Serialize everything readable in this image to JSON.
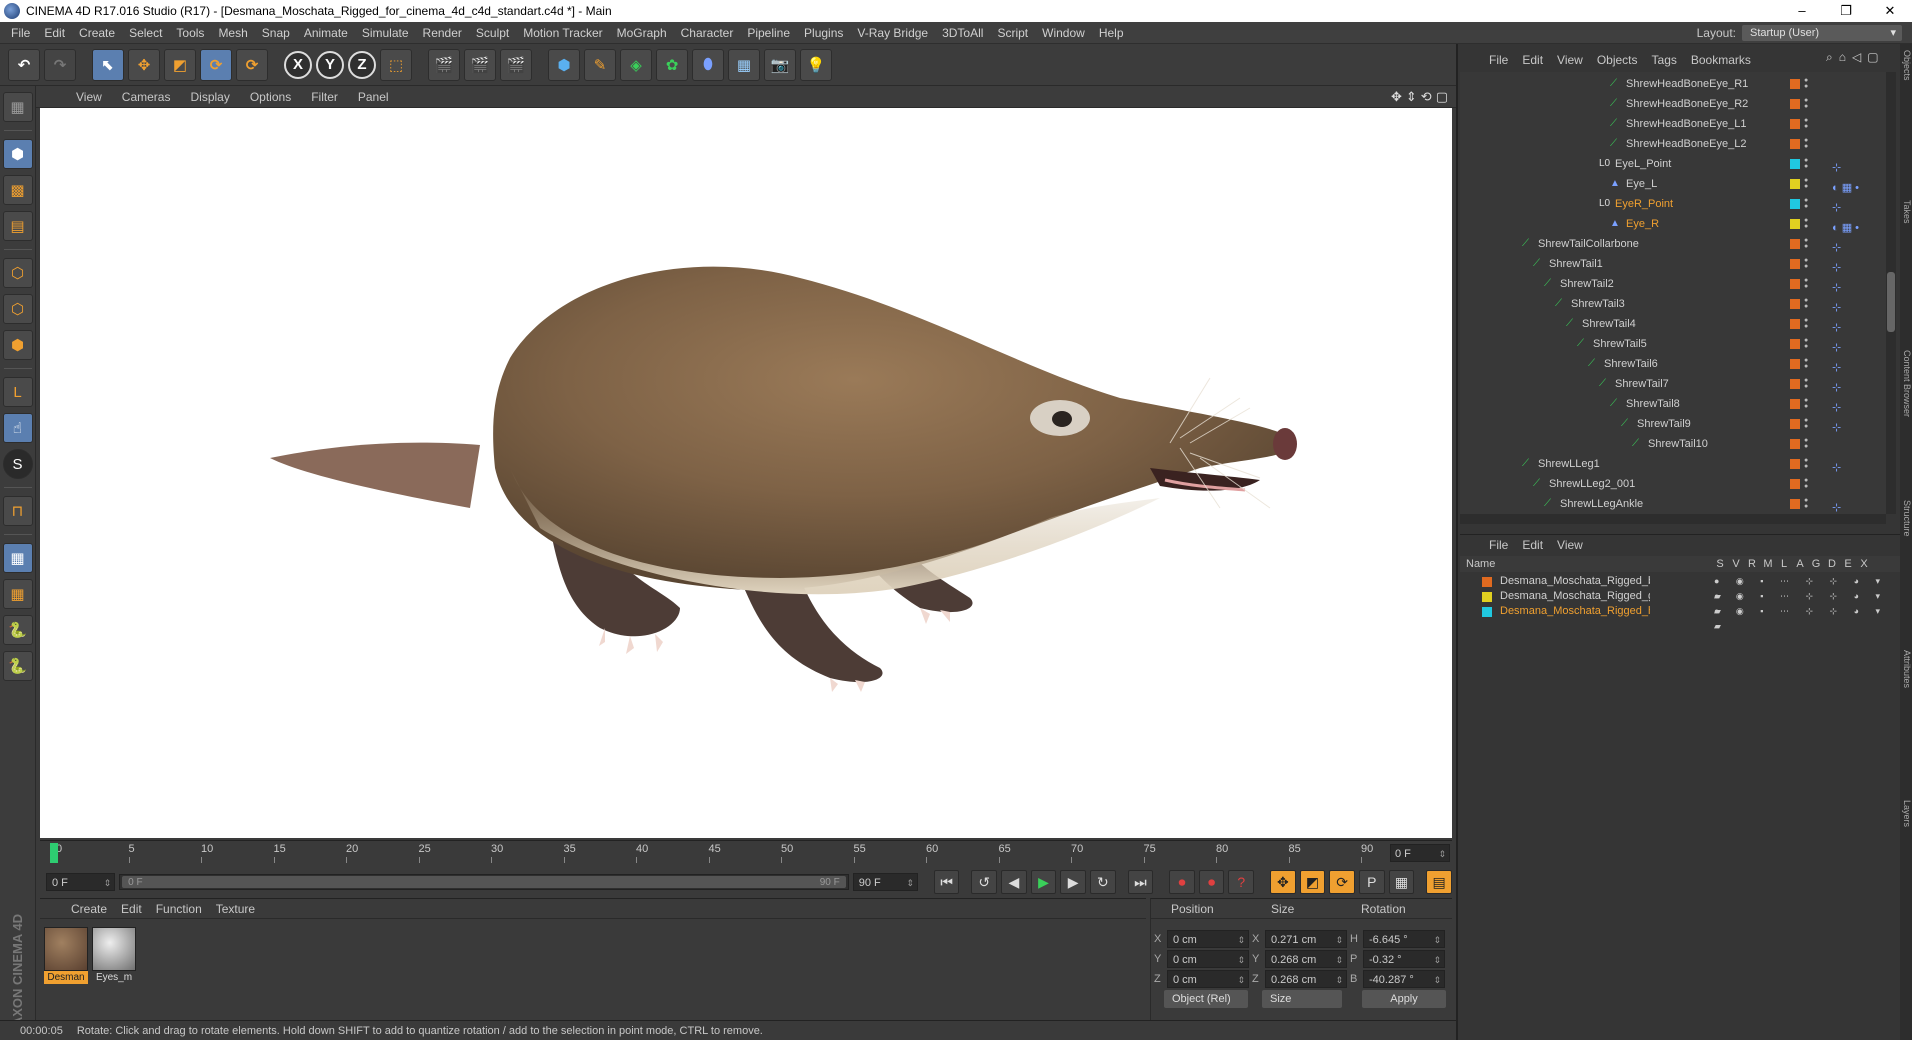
{
  "window": {
    "title": "CINEMA 4D R17.016 Studio (R17) - [Desmana_Moschata_Rigged_for_cinema_4d_c4d_standart.c4d *] - Main",
    "min": "–",
    "max": "❐",
    "close": "✕"
  },
  "menubar": [
    "File",
    "Edit",
    "Create",
    "Select",
    "Tools",
    "Mesh",
    "Snap",
    "Animate",
    "Simulate",
    "Render",
    "Sculpt",
    "Motion Tracker",
    "MoGraph",
    "Character",
    "Pipeline",
    "Plugins",
    "V-Ray Bridge",
    "3DToAll",
    "Script",
    "Window",
    "Help"
  ],
  "layout": {
    "label": "Layout:",
    "value": "Startup (User)"
  },
  "toolbar": {
    "axes": [
      "X",
      "Y",
      "Z"
    ]
  },
  "viewport": {
    "menu": [
      "View",
      "Cameras",
      "Display",
      "Options",
      "Filter",
      "Panel"
    ],
    "nav_icons": [
      "move-view-icon",
      "scale-view-icon",
      "rotate-view-icon",
      "maximize-view-icon"
    ]
  },
  "timeline": {
    "ticks": [
      "0",
      "5",
      "10",
      "15",
      "20",
      "25",
      "30",
      "35",
      "40",
      "45",
      "50",
      "55",
      "60",
      "65",
      "70",
      "75",
      "80",
      "85",
      "90"
    ],
    "current_frame": "0 F"
  },
  "transport": {
    "start": "0 F",
    "range_start": "0 F",
    "range_end": "90 F",
    "end": "90 F"
  },
  "materials": {
    "menu": [
      "Create",
      "Edit",
      "Function",
      "Texture"
    ],
    "items": [
      {
        "name": "Desman",
        "selected": true
      },
      {
        "name": "Eyes_m",
        "selected": false
      }
    ]
  },
  "coordinates": {
    "headers": [
      "Position",
      "Size",
      "Rotation"
    ],
    "rows": [
      {
        "axis": "X",
        "pos": "0 cm",
        "size_axis": "X",
        "size": "0.271 cm",
        "rot_axis": "H",
        "rot": "-6.645 °"
      },
      {
        "axis": "Y",
        "pos": "0 cm",
        "size_axis": "Y",
        "size": "0.268 cm",
        "rot_axis": "P",
        "rot": "-0.32 °"
      },
      {
        "axis": "Z",
        "pos": "0 cm",
        "size_axis": "Z",
        "size": "0.268 cm",
        "rot_axis": "B",
        "rot": "-40.287 °"
      }
    ],
    "mode": "Object (Rel)",
    "size_mode": "Size",
    "apply": "Apply"
  },
  "status": {
    "time": "00:00:05",
    "message": "Rotate: Click and drag to rotate elements. Hold down SHIFT to add to quantize rotation / add to the selection in point mode, CTRL to remove."
  },
  "objects": {
    "menu": [
      "File",
      "Edit",
      "View",
      "Objects",
      "Tags",
      "Bookmarks"
    ],
    "rows": [
      {
        "name": "ShrewHeadBoneEye_R1",
        "depth": 8,
        "color": "#e06a20",
        "tag": ""
      },
      {
        "name": "ShrewHeadBoneEye_R2",
        "depth": 8,
        "color": "#e06a20",
        "tag": ""
      },
      {
        "name": "ShrewHeadBoneEye_L1",
        "depth": 8,
        "color": "#e06a20",
        "tag": ""
      },
      {
        "name": "ShrewHeadBoneEye_L2",
        "depth": 8,
        "color": "#e06a20",
        "tag": ""
      },
      {
        "name": "EyeL_Point",
        "depth": 7,
        "color": "#20c8e0",
        "tag": "⊹",
        "null": true
      },
      {
        "name": "Eye_L",
        "depth": 8,
        "color": "#e0d020",
        "tag": "◐ ▦ •",
        "mesh": true
      },
      {
        "name": "EyeR_Point",
        "depth": 7,
        "color": "#20c8e0",
        "tag": "⊹",
        "null": true,
        "highlight": true
      },
      {
        "name": "Eye_R",
        "depth": 8,
        "color": "#e0d020",
        "tag": "◐ ▦ •",
        "mesh": true,
        "highlight": true
      },
      {
        "name": "ShrewTailCollarbone",
        "depth": 0,
        "color": "#e06a20",
        "tag": "⊹"
      },
      {
        "name": "ShrewTail1",
        "depth": 1,
        "color": "#e06a20",
        "tag": "⊹"
      },
      {
        "name": "ShrewTail2",
        "depth": 2,
        "color": "#e06a20",
        "tag": "⊹"
      },
      {
        "name": "ShrewTail3",
        "depth": 3,
        "color": "#e06a20",
        "tag": "⊹"
      },
      {
        "name": "ShrewTail4",
        "depth": 4,
        "color": "#e06a20",
        "tag": "⊹"
      },
      {
        "name": "ShrewTail5",
        "depth": 5,
        "color": "#e06a20",
        "tag": "⊹"
      },
      {
        "name": "ShrewTail6",
        "depth": 6,
        "color": "#e06a20",
        "tag": "⊹"
      },
      {
        "name": "ShrewTail7",
        "depth": 7,
        "color": "#e06a20",
        "tag": "⊹"
      },
      {
        "name": "ShrewTail8",
        "depth": 8,
        "color": "#e06a20",
        "tag": "⊹"
      },
      {
        "name": "ShrewTail9",
        "depth": 9,
        "color": "#e06a20",
        "tag": "⊹"
      },
      {
        "name": "ShrewTail10",
        "depth": 10,
        "color": "#e06a20",
        "tag": ""
      },
      {
        "name": "ShrewLLeg1",
        "depth": 0,
        "color": "#e06a20",
        "tag": "⊹"
      },
      {
        "name": "ShrewLLeg2_001",
        "depth": 1,
        "color": "#e06a20",
        "tag": ""
      },
      {
        "name": "ShrewLLegAnkle",
        "depth": 2,
        "color": "#e06a20",
        "tag": "⊹"
      }
    ]
  },
  "layers": {
    "menu": [
      "File",
      "Edit",
      "View"
    ],
    "columns": [
      "Name",
      "S",
      "V",
      "R",
      "M",
      "L",
      "A",
      "G",
      "D",
      "E",
      "X"
    ],
    "rows": [
      {
        "name": "Desmana_Moschata_Rigged_bones",
        "color": "#e06a20"
      },
      {
        "name": "Desmana_Moschata_Rigged_geometru",
        "color": "#e0d020"
      },
      {
        "name": "Desmana_Moschata_Rigged_helpers",
        "color": "#20c8e0",
        "highlight": true
      }
    ]
  },
  "sidetabs": [
    "Objects",
    "Takes",
    "Content Browser",
    "Structure",
    "Attributes",
    "Layers"
  ],
  "maxon": "MAXON CINEMA 4D"
}
